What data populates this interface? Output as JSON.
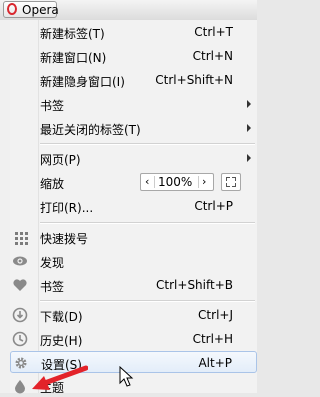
{
  "browser_button": {
    "label": "Opera"
  },
  "menu": {
    "items": [
      {
        "label": "新建标签(T)",
        "shortcut": "Ctrl+T"
      },
      {
        "label": "新建窗口(N)",
        "shortcut": "Ctrl+N"
      },
      {
        "label": "新建隐身窗口(I)",
        "shortcut": "Ctrl+Shift+N"
      },
      {
        "label": "书签",
        "shortcut": ""
      },
      {
        "label": "最近关闭的标签(T)",
        "shortcut": ""
      },
      {
        "label": "网页(P)",
        "shortcut": ""
      },
      {
        "label": "缩放",
        "shortcut": ""
      },
      {
        "label": "打印(R)...",
        "shortcut": "Ctrl+P"
      },
      {
        "label": "快速拨号",
        "shortcut": ""
      },
      {
        "label": "发现",
        "shortcut": ""
      },
      {
        "label": "书签",
        "shortcut": "Ctrl+Shift+B"
      },
      {
        "label": "下载(D)",
        "shortcut": "Ctrl+J"
      },
      {
        "label": "历史(H)",
        "shortcut": "Ctrl+H"
      },
      {
        "label": "设置(S)",
        "shortcut": "Alt+P"
      },
      {
        "label": "主题",
        "shortcut": ""
      }
    ],
    "zoom": {
      "value": "100%",
      "decrease": "‹",
      "increase": "›"
    }
  },
  "colors": {
    "highlight": "#e3edf9",
    "opera_red": "#d9272e",
    "arrow_red": "#e3232a"
  }
}
